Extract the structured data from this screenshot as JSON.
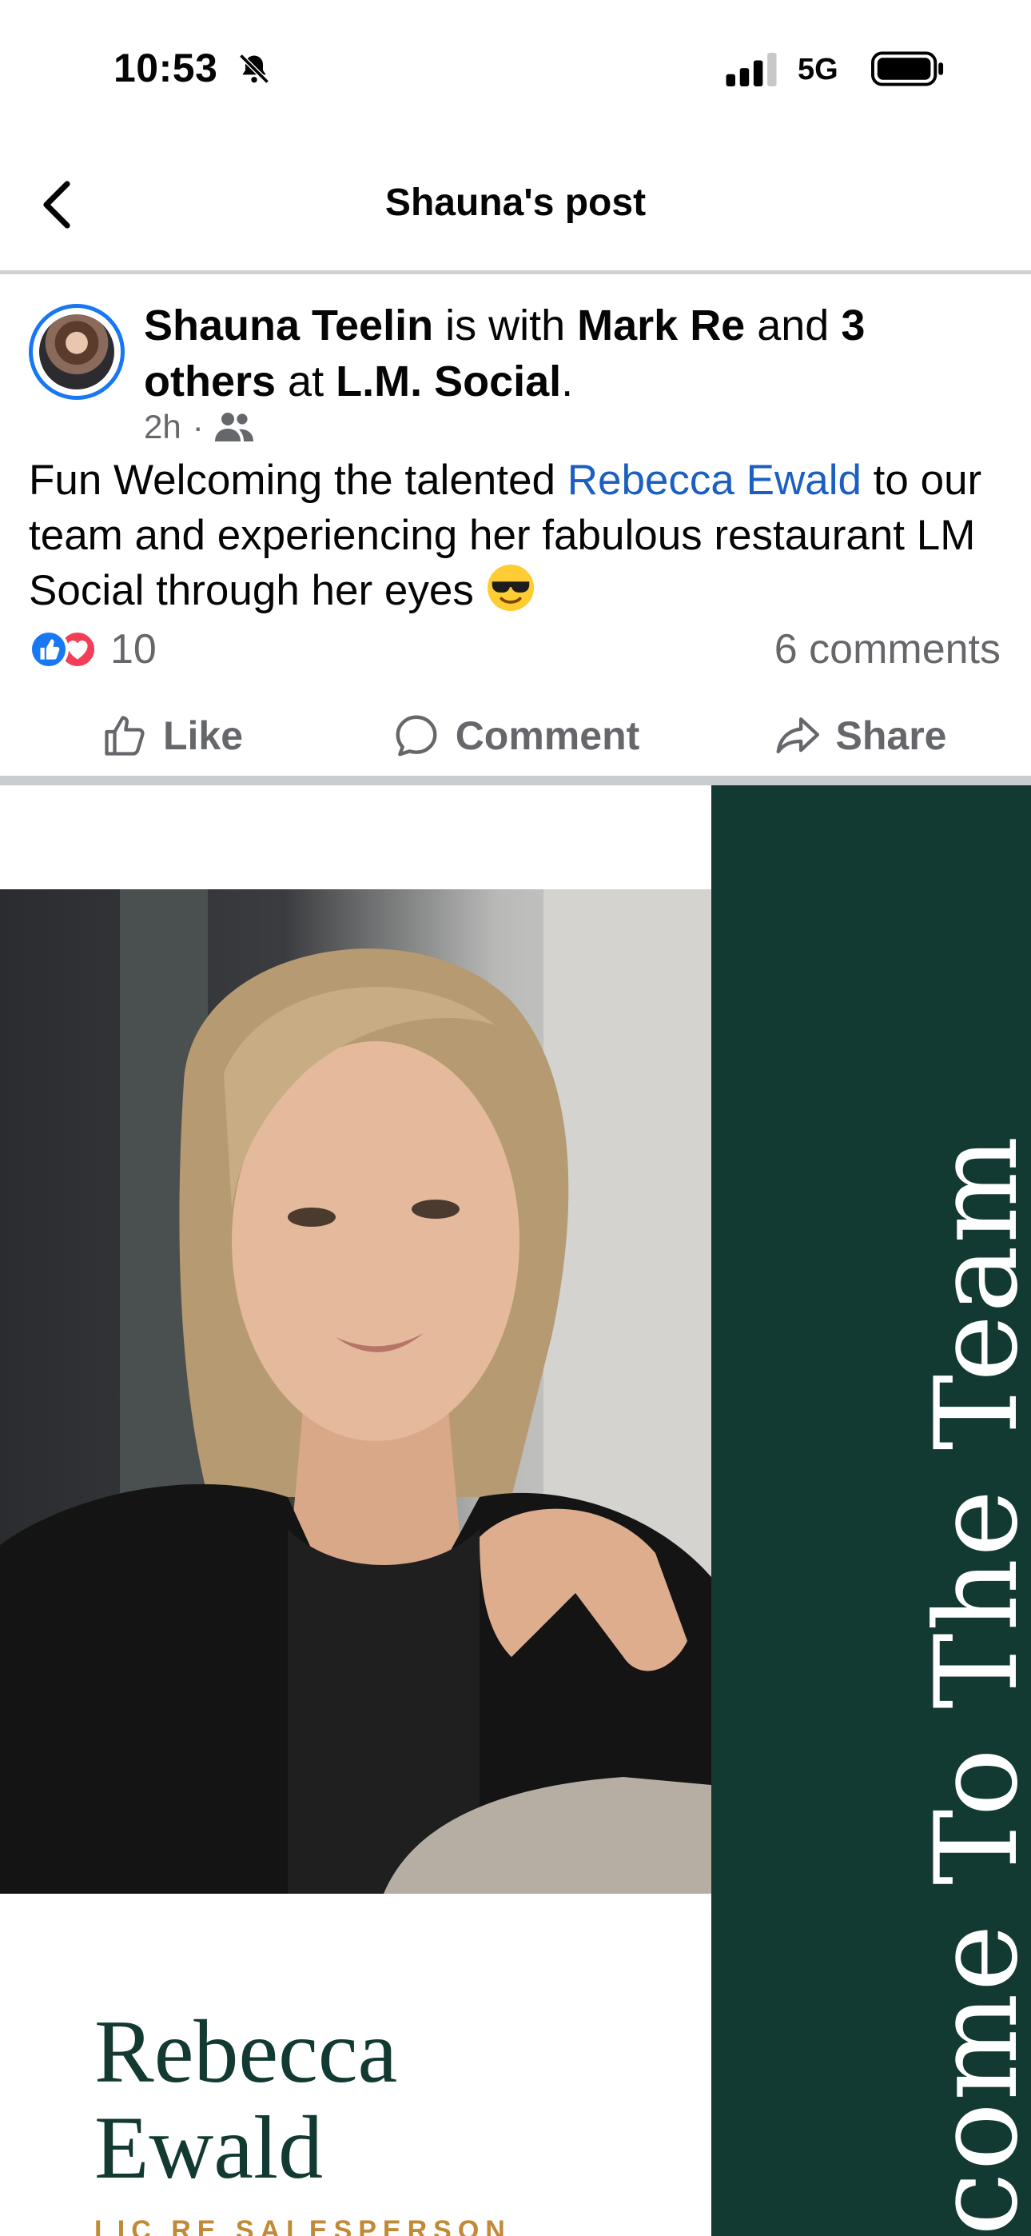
{
  "status_bar": {
    "time": "10:53",
    "network": "5G",
    "icons": [
      "bell-off-icon",
      "signal-icon",
      "battery-icon"
    ]
  },
  "header": {
    "title": "Shauna's post",
    "back_icon": "chevron-left-icon"
  },
  "post": {
    "author": "Shauna Teelin",
    "with_text": " is with ",
    "tagged": "Mark Re",
    "and_text": " and ",
    "others": "3 others",
    "at_text": " at ",
    "location": "L.M. Social",
    "period": ".",
    "time_ago": "2h",
    "audience_icon": "friends-icon",
    "text_before": "Fun Welcoming the talented ",
    "mention": "Rebecca Ewald",
    "text_after": " to our team and experiencing her fabulous restaurant LM Social through her eyes ",
    "emoji_icon": "sunglasses-emoji-icon"
  },
  "engagement": {
    "reactions_count": "10",
    "comments_label": "6 comments",
    "reaction_icons": [
      "like-reaction-icon",
      "love-reaction-icon"
    ]
  },
  "actions": [
    {
      "label": "Like",
      "icon": "thumbs-up-icon"
    },
    {
      "label": "Comment",
      "icon": "comment-bubble-icon"
    },
    {
      "label": "Share",
      "icon": "share-arrow-icon"
    }
  ],
  "photo": {
    "vertical_caption": "come To The Team",
    "name_line1": "Rebecca",
    "name_line2": "Ewald",
    "role": "LIC RE SALESPERSON"
  },
  "colors": {
    "link": "#1b5fc1",
    "facebook_blue": "#1877f2",
    "love_red": "#f33e58",
    "secondary_text": "#65676b",
    "brand_green": "#123a32",
    "gold": "#c08a36"
  }
}
